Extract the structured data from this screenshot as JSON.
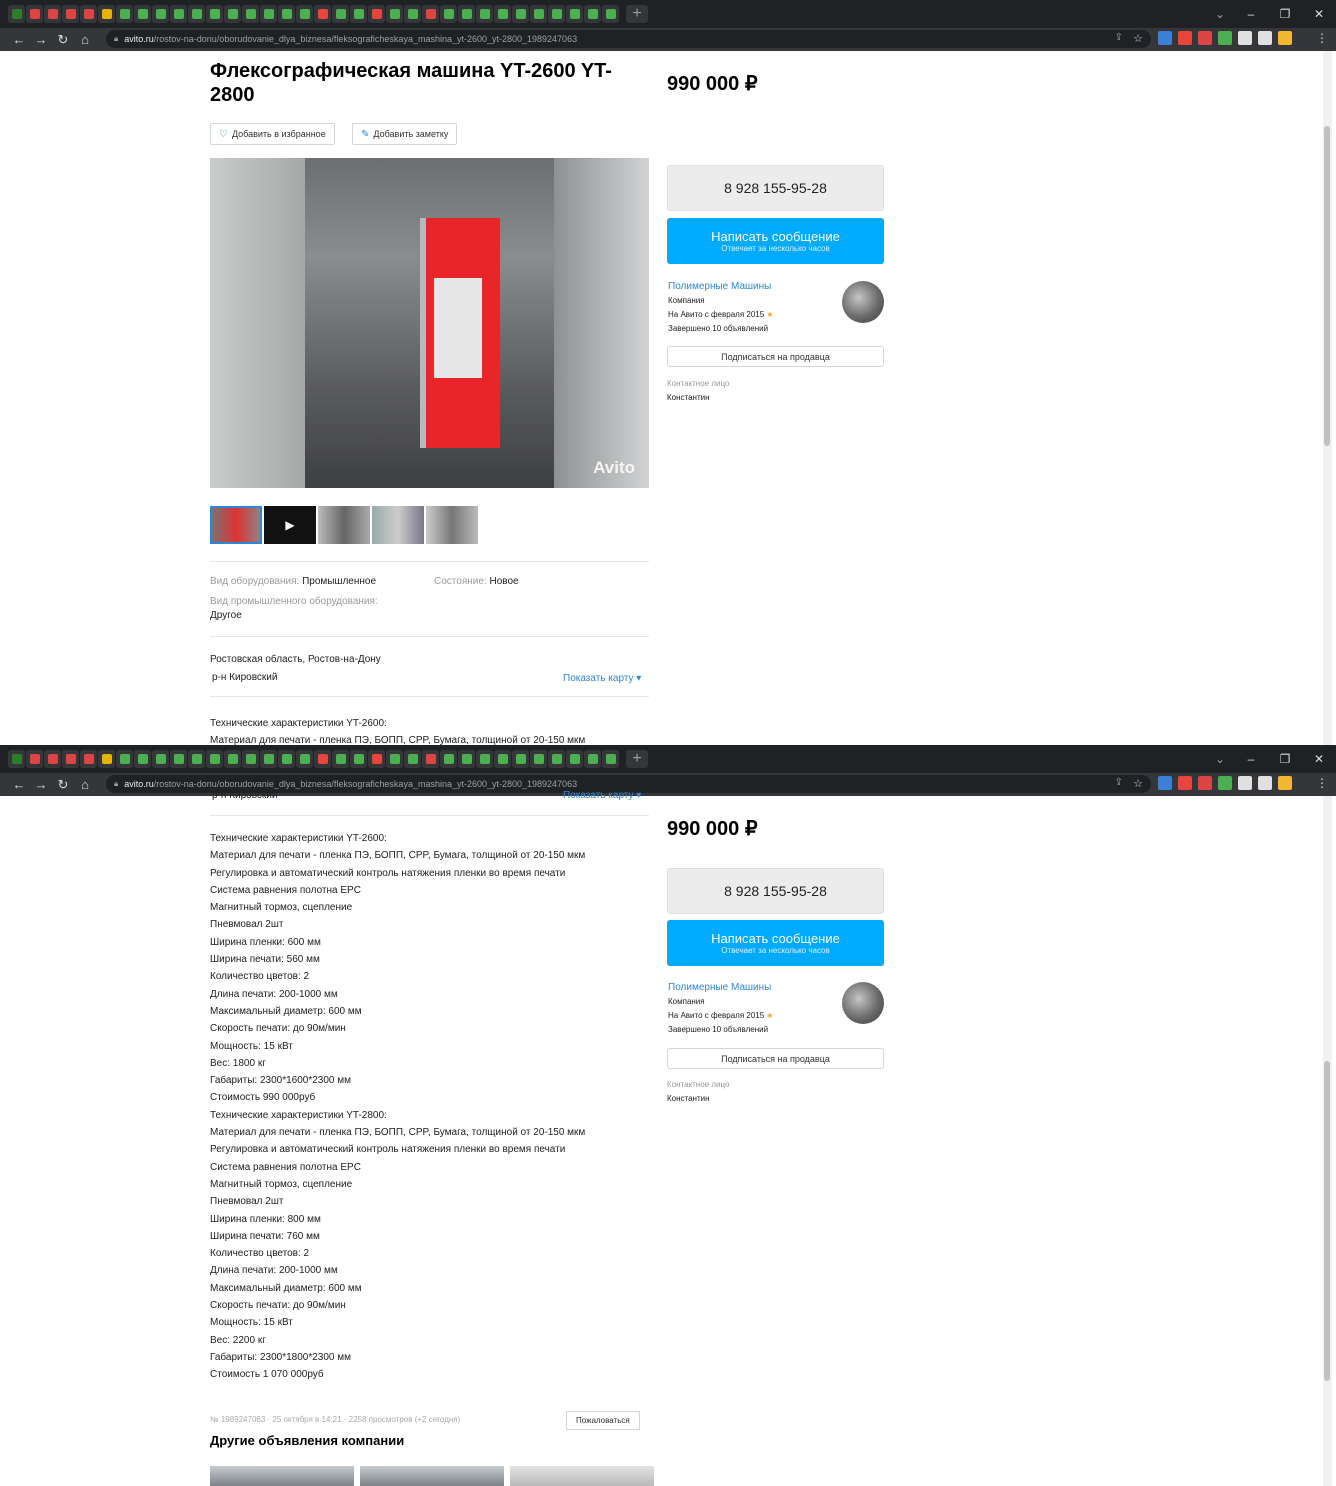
{
  "browser": {
    "url_host": "avito.ru",
    "url_path": "/rostov-na-donu/oborudovanie_dlya_biznesa/fleksograficheskaya_mashina_yt-2600_yt-2800_1989247063",
    "tab_colors": [
      "#2d7d2d",
      "#d44",
      "#d44",
      "#d44",
      "#d44",
      "#e6b400",
      "#4caf50",
      "#4caf50",
      "#4caf50",
      "#4caf50",
      "#4caf50",
      "#4caf50",
      "#4caf50",
      "#4caf50",
      "#4caf50",
      "#4caf50",
      "#4caf50",
      "#e8453c",
      "#4caf50",
      "#4caf50",
      "#e8453c",
      "#4caf50",
      "#4caf50",
      "#d44",
      "#4caf50",
      "#4caf50",
      "#4caf50",
      "#4caf50",
      "#4caf50",
      "#4caf50",
      "#4caf50",
      "#4caf50",
      "#4caf50",
      "#4caf50"
    ],
    "ext_colors": [
      "#3b7fd6",
      "#e8453c",
      "#d44",
      "#4caf50",
      "#e0e0e0",
      "#e0e0e0",
      "#f2b631"
    ]
  },
  "listing": {
    "title": "Флексографическая машина YT-2600 YT-2800",
    "price": "990 000 ₽",
    "add_favorite": "Добавить в избранное",
    "add_note": "Добавить заметку",
    "photo_watermark": "Avito",
    "params": {
      "equipment_type_label": "Вид оборудования:",
      "equipment_type_value": "Промышленное",
      "condition_label": "Состояние:",
      "condition_value": "Новое",
      "industrial_type_label": "Вид промышленного оборудования:",
      "industrial_type_value": "Другое"
    },
    "location": {
      "region": "Ростовская область, Ростов-на-Дону",
      "district": "р-н Кировский",
      "show_map": "Показать карту"
    },
    "description_preview": [
      "Технические характеристики YT-2600:",
      "Материал для печати - пленка ПЭ, БОПП, CPP, Бумага, толщиной от 20-150 мкм"
    ],
    "description": [
      "Технические характеристики YT-2600:",
      "Материал для печати - пленка ПЭ, БОПП, CPP, Бумага, толщиной от 20-150 мкм",
      "Регулировка и автоматический контроль натяжения пленки во время печати",
      "Система равнения полотна EPC",
      "Магнитный тормоз, сцепление",
      "Пневмовал 2шт",
      "Ширина пленки: 600 мм",
      "Ширина печати: 560 мм",
      "Количество цветов: 2",
      "Длина печати: 200-1000 мм",
      "Максимальный диаметр: 600 мм",
      "Скорость печати: до 90м/мин",
      "Мощность: 15 кВт",
      "Вес: 1800 кг",
      "Габариты: 2300*1600*2300 мм",
      "Стоимость 990 000руб",
      "Технические характеристики YT-2800:",
      "Материал для печати - пленка ПЭ, БОПП, CPP, Бумага, толщиной от 20-150 мкм",
      "Регулировка и автоматический контроль натяжения пленки во время печати",
      "Система равнения полотна EPC",
      "Магнитный тормоз, сцепление",
      "Пневмовал 2шт",
      "Ширина пленки: 800 мм",
      "Ширина печати: 760 мм",
      "Количество цветов: 2",
      "Длина печати: 200-1000 мм",
      "Максимальный диаметр: 600 мм",
      "Скорость печати: до 90м/мин",
      "Мощность: 15 кВт",
      "Вес: 2200 кг",
      "Габариты: 2300*1800*2300 мм",
      "Стоимость 1 070 000руб"
    ],
    "meta": "№ 1989247063 · 25 октября в 14:21 · 2258 просмотров (+2 сегодня)",
    "complain": "Пожаловаться",
    "other_ads_title": "Другие объявления компании"
  },
  "seller": {
    "phone": "8 928 155-95-28",
    "message_button": "Написать сообщение",
    "message_sub": "Отвечает за несколько часов",
    "name": "Полимерные Машины",
    "type": "Компания",
    "since": "На Авито с февраля 2015",
    "completed": "Завершено 10 объявлений",
    "subscribe": "Подписаться на продавца",
    "contact_label": "Контактное лицо",
    "contact_name": "Константин"
  }
}
